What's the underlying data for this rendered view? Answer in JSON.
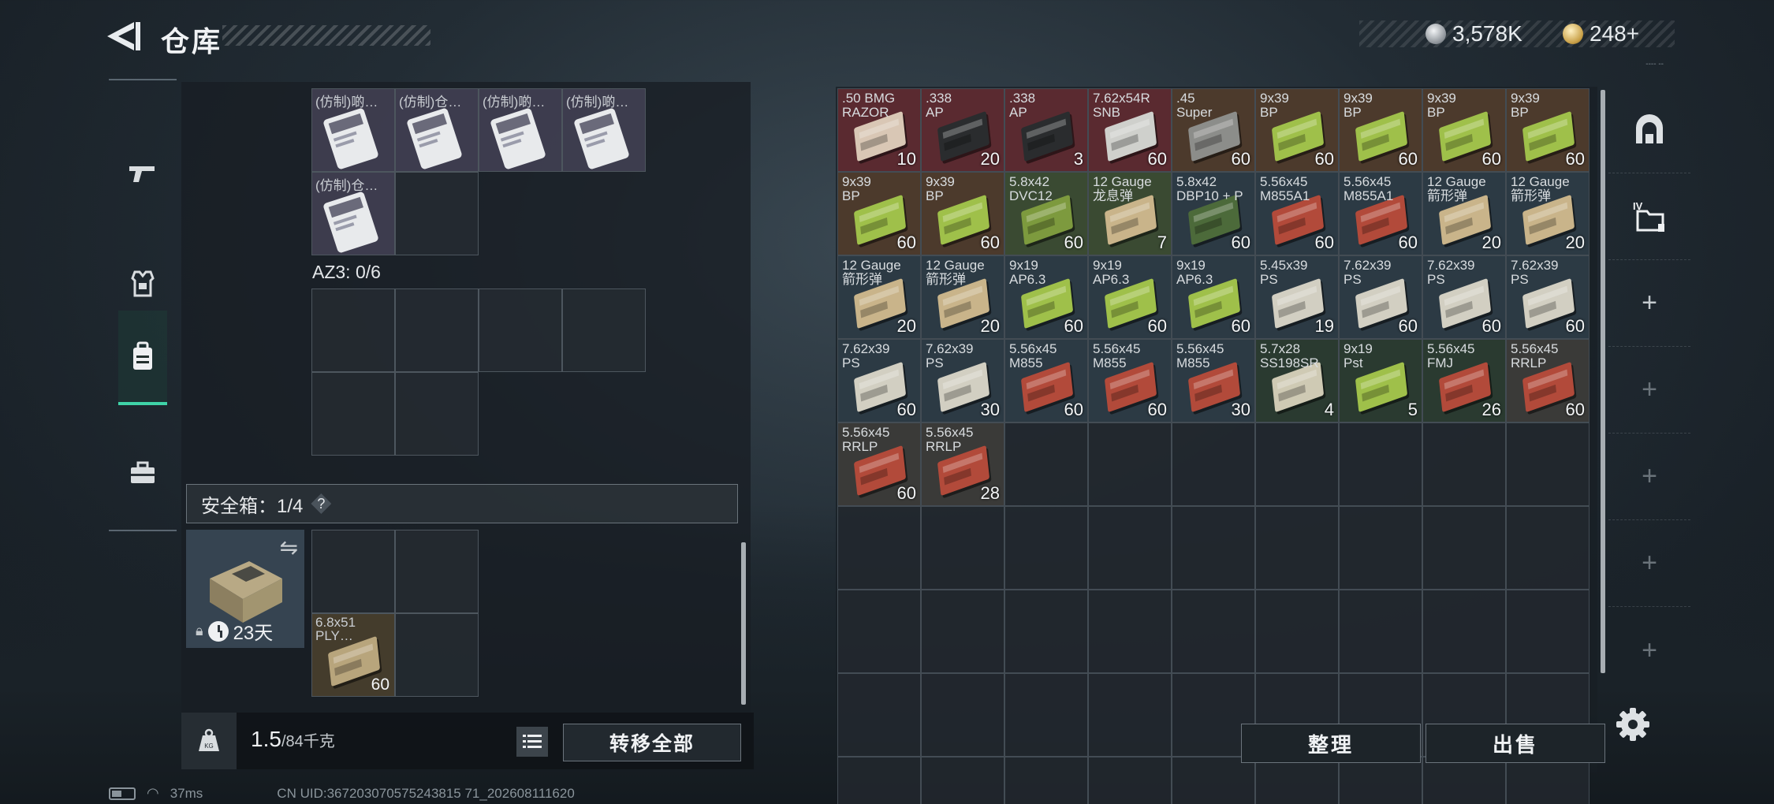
{
  "header": {
    "title": "仓库",
    "currency_1": "3,578K",
    "currency_2": "248+",
    "version": "---- --"
  },
  "left": {
    "items_top": [
      {
        "label": "(仿制)啲…",
        "filled": true
      },
      {
        "label": "(仿制)仓…",
        "filled": true
      },
      {
        "label": "(仿制)啲…",
        "filled": true
      },
      {
        "label": "(仿制)啲…",
        "filled": true
      },
      {
        "label": "(仿制)仓…",
        "filled": true
      },
      {
        "label": "",
        "filled": false
      }
    ],
    "az3_label": "AZ3: 0/6",
    "safe_label": "安全箱：1/4",
    "help_symbol": "?",
    "safe_days": "23天",
    "safe_item": {
      "label": "6.8x51\nPLY…",
      "count": "60"
    },
    "weight_value": "1.5",
    "weight_max": "/84千克",
    "weight_icon_text": "KG",
    "transfer_all": "转移全部"
  },
  "stash": {
    "items": [
      {
        "label": ".50 BMG\nRAZOR",
        "count": "10",
        "bg": "#5a2a30",
        "box": "#d9c7b5"
      },
      {
        "label": ".338\nAP",
        "count": "20",
        "bg": "#5a2a30",
        "box": "#2a2c2e"
      },
      {
        "label": ".338\nAP",
        "count": "3",
        "bg": "#5a2a30",
        "box": "#2a2c2e"
      },
      {
        "label": "7.62x54R\nSNB",
        "count": "60",
        "bg": "#5a2a30",
        "box": "#cfd0cc"
      },
      {
        "label": ".45\nSuper",
        "count": "60",
        "bg": "#4c3a2c",
        "box": "#8c8d8a"
      },
      {
        "label": "9x39\nBP",
        "count": "60",
        "bg": "#4c3a2c",
        "box": "#9fc04a"
      },
      {
        "label": "9x39\nBP",
        "count": "60",
        "bg": "#4c3a2c",
        "box": "#9fc04a"
      },
      {
        "label": "9x39\nBP",
        "count": "60",
        "bg": "#4c3a2c",
        "box": "#9fc04a"
      },
      {
        "label": "9x39\nBP",
        "count": "60",
        "bg": "#4c3a2c",
        "box": "#9fc04a"
      },
      {
        "label": "9x39\nBP",
        "count": "60",
        "bg": "#4c3a2c",
        "box": "#9fc04a"
      },
      {
        "label": "9x39\nBP",
        "count": "60",
        "bg": "#4c3a2c",
        "box": "#9fc04a"
      },
      {
        "label": "5.8x42\nDVC12",
        "count": "60",
        "bg": "#3a4a32",
        "box": "#7d9a3e"
      },
      {
        "label": "12 Gauge\n龙息弹",
        "count": "7",
        "bg": "#3a4a32",
        "box": "#c9b48a"
      },
      {
        "label": "5.8x42\nDBP10 + P",
        "count": "60",
        "bg": "#2c3a44",
        "box": "#4c6a3a"
      },
      {
        "label": "5.56x45\nM855A1",
        "count": "60",
        "bg": "#2c3a44",
        "box": "#b24a3a"
      },
      {
        "label": "5.56x45\nM855A1",
        "count": "60",
        "bg": "#2c3a44",
        "box": "#b24a3a"
      },
      {
        "label": "12 Gauge\n箭形弹",
        "count": "20",
        "bg": "#2c3a44",
        "box": "#c9b48a"
      },
      {
        "label": "12 Gauge\n箭形弹",
        "count": "20",
        "bg": "#2c3a44",
        "box": "#c9b48a"
      },
      {
        "label": "12 Gauge\n箭形弹",
        "count": "20",
        "bg": "#2c3a44",
        "box": "#c9b48a"
      },
      {
        "label": "12 Gauge\n箭形弹",
        "count": "20",
        "bg": "#2c3a44",
        "box": "#c9b48a"
      },
      {
        "label": "9x19\nAP6.3",
        "count": "60",
        "bg": "#2c3a44",
        "box": "#9fc04a"
      },
      {
        "label": "9x19\nAP6.3",
        "count": "60",
        "bg": "#2c3a44",
        "box": "#9fc04a"
      },
      {
        "label": "9x19\nAP6.3",
        "count": "60",
        "bg": "#2c3a44",
        "box": "#9fc04a"
      },
      {
        "label": "5.45x39\nPS",
        "count": "19",
        "bg": "#2c3a44",
        "box": "#d2cfc2"
      },
      {
        "label": "7.62x39\nPS",
        "count": "60",
        "bg": "#2c3a44",
        "box": "#d2cfc2"
      },
      {
        "label": "7.62x39\nPS",
        "count": "60",
        "bg": "#2c3a44",
        "box": "#d2cfc2"
      },
      {
        "label": "7.62x39\nPS",
        "count": "60",
        "bg": "#2c3a44",
        "box": "#d2cfc2"
      },
      {
        "label": "7.62x39\nPS",
        "count": "60",
        "bg": "#2c3a44",
        "box": "#d2cfc2"
      },
      {
        "label": "7.62x39\nPS",
        "count": "30",
        "bg": "#2c3a44",
        "box": "#d2cfc2"
      },
      {
        "label": "5.56x45\nM855",
        "count": "60",
        "bg": "#2c3a44",
        "box": "#b24a3a"
      },
      {
        "label": "5.56x45\nM855",
        "count": "60",
        "bg": "#2c3a44",
        "box": "#b24a3a"
      },
      {
        "label": "5.56x45\nM855",
        "count": "30",
        "bg": "#2c3a44",
        "box": "#b24a3a"
      },
      {
        "label": "5.7x28\nSS198SR",
        "count": "4",
        "bg": "#2a3a30",
        "box": "#cfcab4"
      },
      {
        "label": "9x19\nPst",
        "count": "5",
        "bg": "#2a3a30",
        "box": "#9fc04a"
      },
      {
        "label": "5.56x45\nFMJ",
        "count": "26",
        "bg": "#2a3a30",
        "box": "#b24a3a"
      },
      {
        "label": "5.56x45\nRRLP",
        "count": "60",
        "bg": "#3a3a38",
        "box": "#b24a3a"
      },
      {
        "label": "5.56x45\nRRLP",
        "count": "60",
        "bg": "#3a3a38",
        "box": "#b24a3a"
      },
      {
        "label": "5.56x45\nRRLP",
        "count": "28",
        "bg": "#3a3a38",
        "box": "#b24a3a"
      }
    ],
    "empty_cells": 43,
    "sort_label": "整理",
    "sell_label": "出售"
  },
  "rail": {
    "plus": "+"
  },
  "status": {
    "ping": "37ms",
    "uid": "CN UID:367203070575243815 71_202608111620"
  }
}
